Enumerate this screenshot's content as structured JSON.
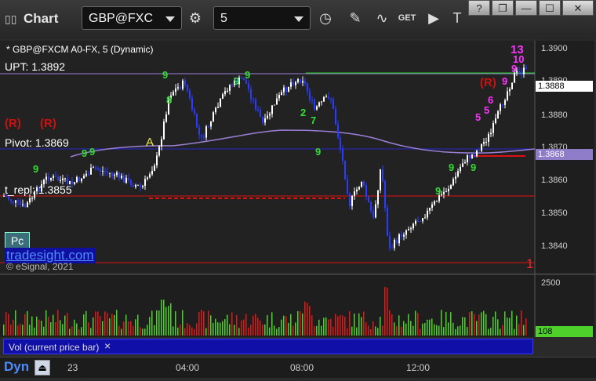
{
  "toolbar": {
    "app_title": "Chart",
    "symbol": "GBP@FXC",
    "interval": "5",
    "icons": [
      "settings-gear-icon",
      "clock-icon",
      "pencil-icon",
      "indicator-icon",
      "get-icon",
      "play-icon",
      "text-icon"
    ],
    "window_controls": [
      "?",
      "❐",
      "—",
      "☐",
      "✕"
    ]
  },
  "chart": {
    "title": "* GBP@FXCM A0-FX, 5 (Dynamic)",
    "upt_label": "UPT: 1.3892",
    "pivot_label": "Pivot: 1.3869",
    "support_label": "t_repl: 1.3855",
    "mark_a": "A",
    "mark_r": "(R)",
    "count_1": "1",
    "seq_top": "13",
    "watermark_site": "tradesight.com",
    "watermark_copy": "© eSignal, 2021",
    "pc_label": "Pc",
    "price_axis": [
      "1.3900",
      "1.3890",
      "1.3880",
      "1.3870",
      "1.3860",
      "1.3850",
      "1.3840"
    ],
    "current_price": "1.3888",
    "ma_price": "1.3868",
    "volume_axis_top": "2500",
    "volume_current": "108",
    "volume_label": "Vol (current price bar)",
    "close_x": "×",
    "colors": {
      "up": "#ffffff",
      "down": "#2a3cff",
      "pivot": "#2727d0",
      "resistance": "#dd1111",
      "upt": "#22cc22",
      "ma": "#9b7fd6",
      "seq_green": "#33dd33",
      "seq_magenta": "#ff33ff"
    }
  },
  "bottom": {
    "dyn_label": "Dyn",
    "time_labels": [
      "23",
      "04:00",
      "08:00",
      "12:00"
    ]
  }
}
